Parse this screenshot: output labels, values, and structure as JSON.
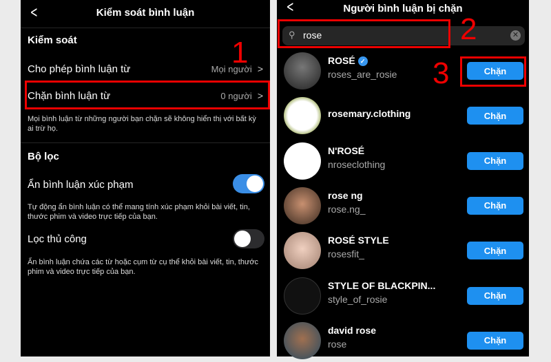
{
  "left": {
    "title": "Kiểm soát bình luận",
    "section1": "Kiểm soát",
    "allow_label": "Cho phép bình luận từ",
    "allow_value": "Mọi người",
    "block_label": "Chặn bình luận từ",
    "block_value": "0 người",
    "block_desc": "Mọi bình luận từ những người bạn chặn sẽ không hiển thị với bất kỳ ai trừ họ.",
    "section2": "Bộ lọc",
    "hide_label": "Ẩn bình luận xúc phạm",
    "hide_on": true,
    "hide_desc": "Tự động ẩn bình luận có thể mang tính xúc phạm khỏi bài viết, tin, thước phim và video trực tiếp của bạn.",
    "manual_label": "Lọc thủ công",
    "manual_on": false,
    "manual_desc": "Ẩn bình luận chứa các từ hoặc cụm từ cụ thể khỏi bài viết, tin, thước phim và video trực tiếp của bạn."
  },
  "right": {
    "title": "Người bình luận bị chặn",
    "search_value": "rose",
    "button_label": "Chặn",
    "results": [
      {
        "name": "ROSÉ",
        "verified": true,
        "username": "roses_are_rosie"
      },
      {
        "name": "rosemary.clothing",
        "username": ""
      },
      {
        "name": "N'ROSÉ",
        "username": "nroseclothing"
      },
      {
        "name": "rose ng",
        "username": "rose.ng_"
      },
      {
        "name": "ROSÉ STYLE",
        "username": "rosesfit_"
      },
      {
        "name": "STYLE OF BLACKPIN...",
        "username": "style_of_rosie"
      },
      {
        "name": "david rose",
        "username": "rose"
      }
    ]
  },
  "annotations": [
    "1",
    "2",
    "3"
  ],
  "colors": {
    "accent": "#1e90f0",
    "highlight": "#e00000",
    "toggle_on": "#3a8ee6",
    "toggle_off": "#2c2c2e"
  }
}
